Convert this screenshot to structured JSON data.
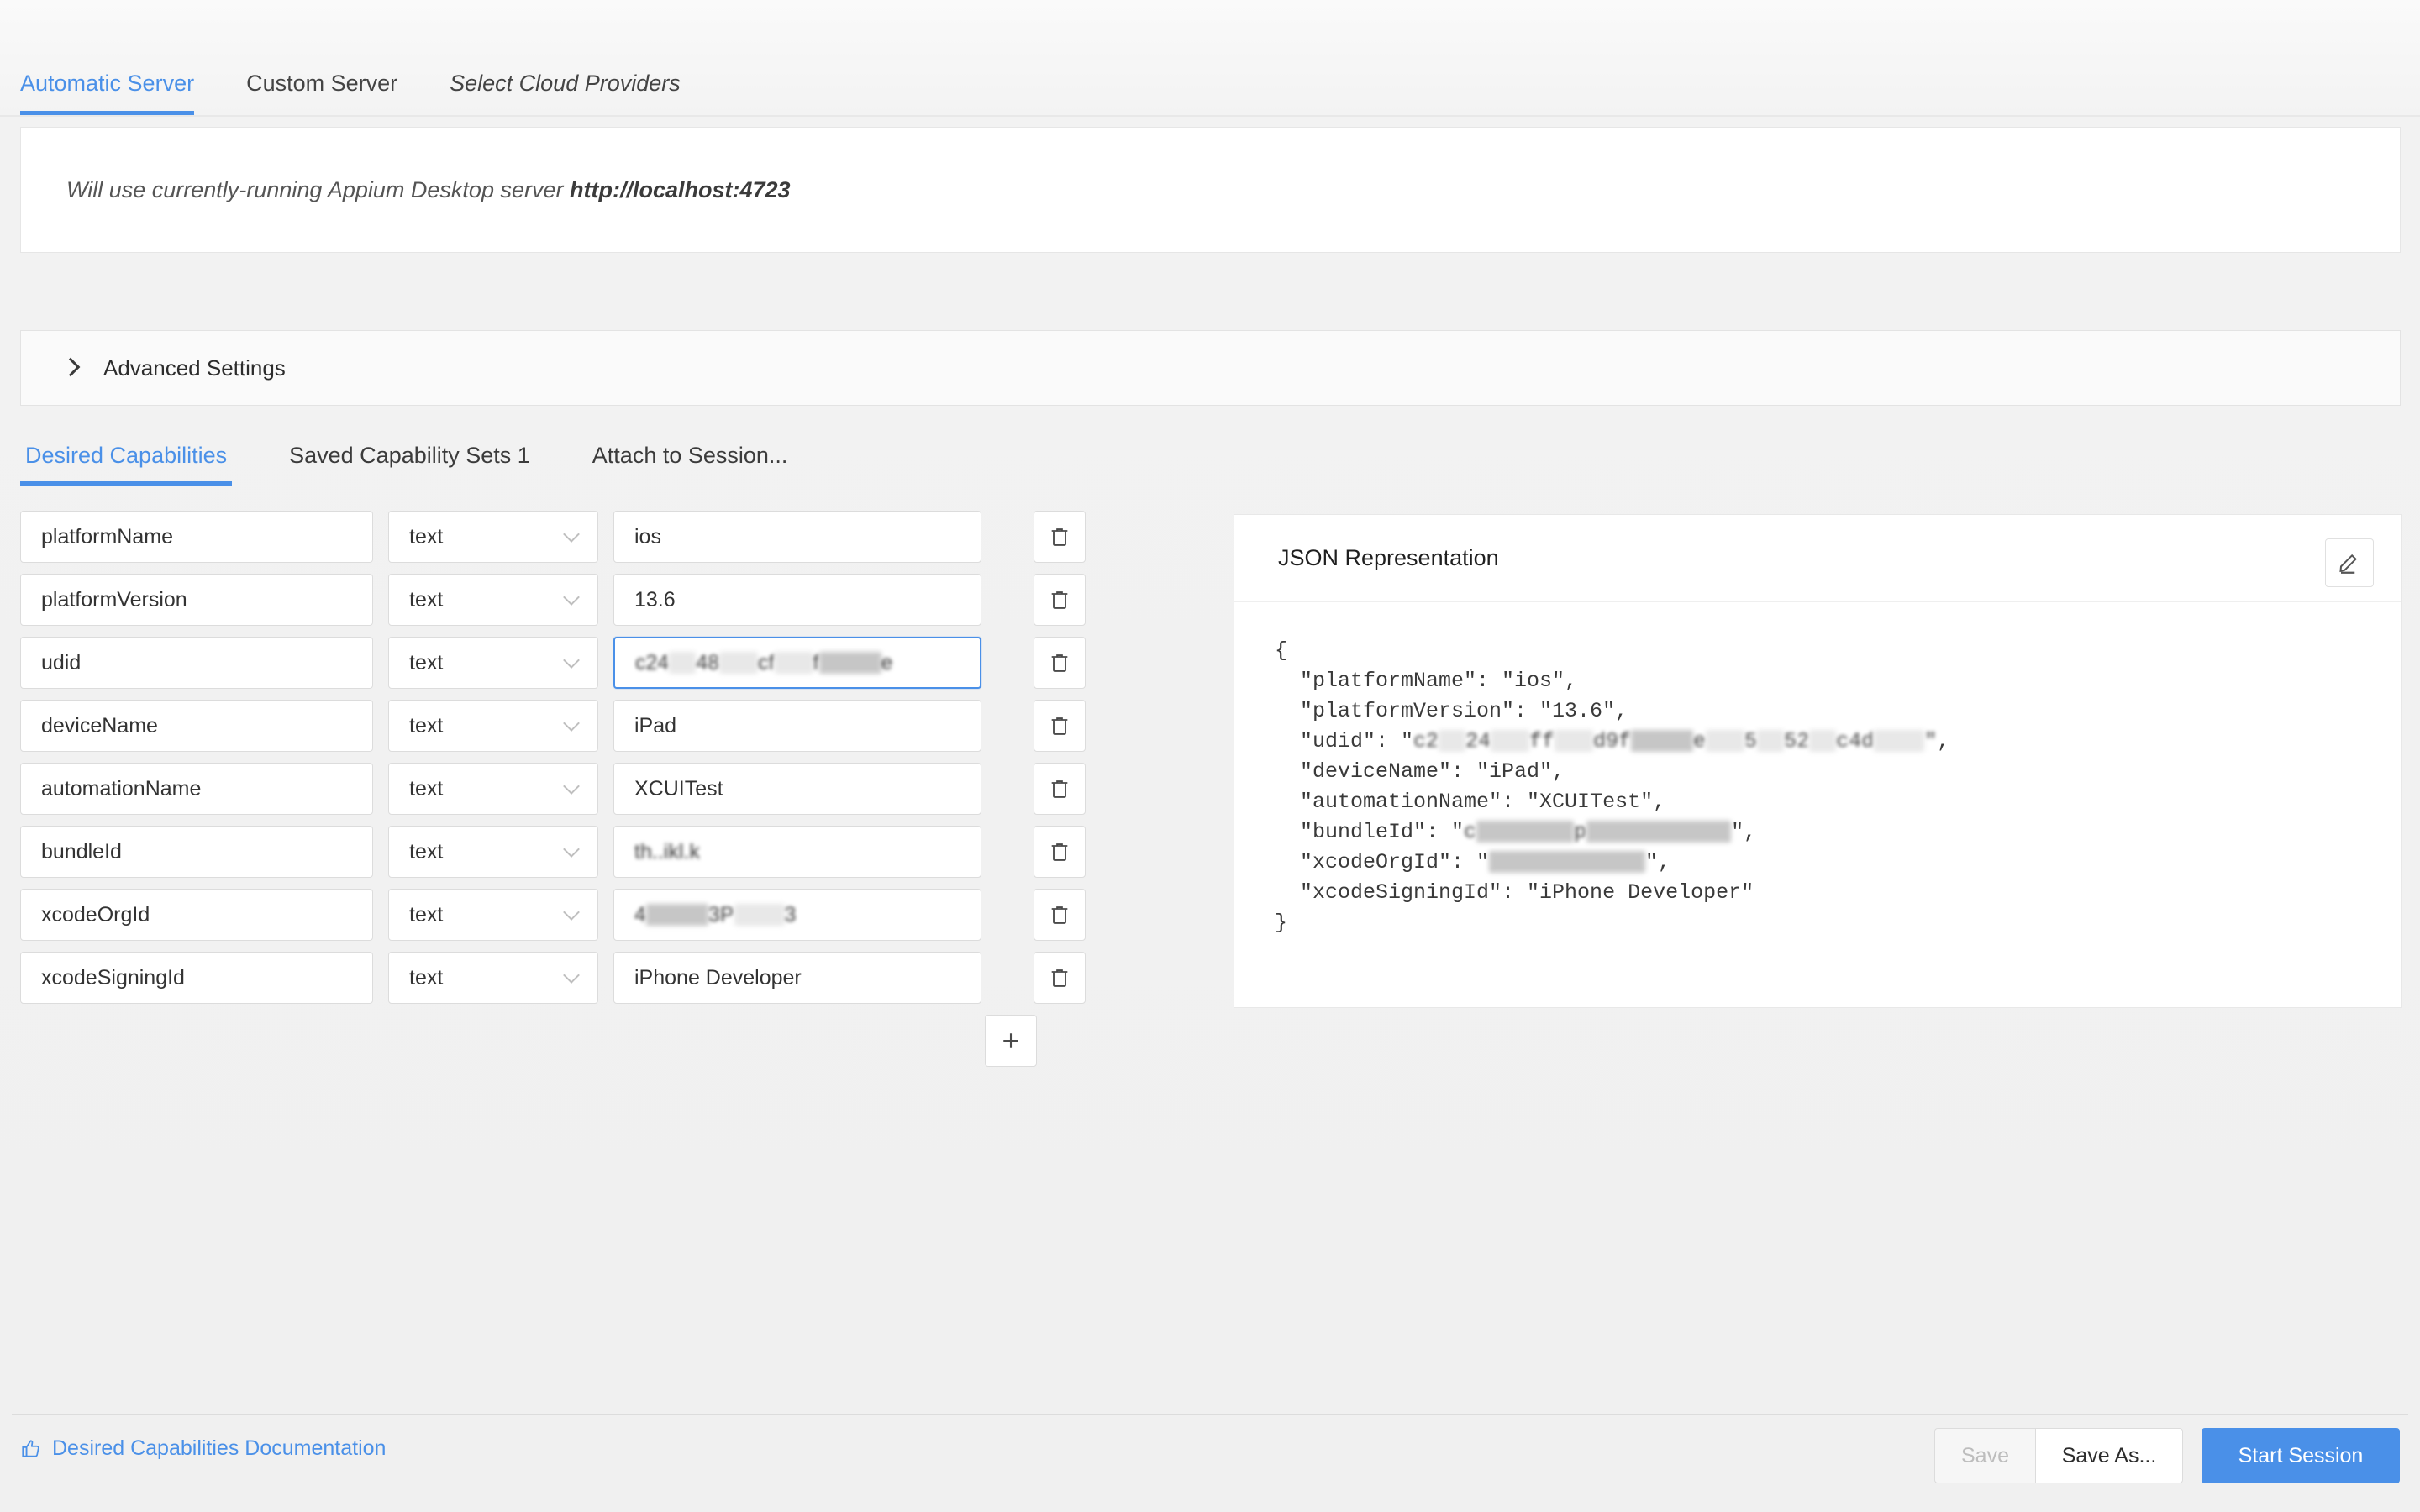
{
  "server_tabs": [
    {
      "label": "Automatic Server",
      "active": true,
      "italic": false
    },
    {
      "label": "Custom Server",
      "active": false,
      "italic": false
    },
    {
      "label": "Select Cloud Providers",
      "active": false,
      "italic": true
    }
  ],
  "server_info": {
    "prefix": "Will use currently-running Appium Desktop server ",
    "url": "http://localhost:4723"
  },
  "advanced": {
    "label": "Advanced Settings",
    "expanded": false
  },
  "caps_tabs": [
    {
      "label": "Desired Capabilities",
      "active": true
    },
    {
      "label": "Saved Capability Sets 1",
      "active": false
    },
    {
      "label": "Attach to Session...",
      "active": false
    }
  ],
  "capabilities": [
    {
      "name": "platformName",
      "type": "text",
      "value": "ios",
      "redacted": false,
      "focused": false
    },
    {
      "name": "platformVersion",
      "type": "text",
      "value": "13.6",
      "redacted": false,
      "focused": false
    },
    {
      "name": "udid",
      "type": "text",
      "value": "c24 48  cf  f    e",
      "redacted": true,
      "focused": true
    },
    {
      "name": "deviceName",
      "type": "text",
      "value": "iPad",
      "redacted": false,
      "focused": false
    },
    {
      "name": "automationName",
      "type": "text",
      "value": "XCUITest",
      "redacted": false,
      "focused": false
    },
    {
      "name": "bundleId",
      "type": "text",
      "value": "th..ikl.k",
      "redacted": true,
      "focused": false
    },
    {
      "name": "xcodeOrgId",
      "type": "text",
      "value": "4    3P   3",
      "redacted": true,
      "focused": false
    },
    {
      "name": "xcodeSigningId",
      "type": "text",
      "value": "iPhone Developer",
      "redacted": false,
      "focused": false
    }
  ],
  "row_actions": {
    "delete_icon": "trash-icon",
    "add_icon": "plus-icon"
  },
  "json_panel": {
    "title": "JSON Representation",
    "edit_icon": "pencil-icon",
    "lines": [
      {
        "text": "{"
      },
      {
        "text": "  \"platformName\": \"ios\","
      },
      {
        "text": "  \"platformVersion\": \"13.6\","
      },
      {
        "text": "  \"udid\": \"",
        "redacted": "c2 24  ff  d9f    e  5 52 c4d   \"",
        "suffix": ","
      },
      {
        "text": "  \"deviceName\": \"iPad\","
      },
      {
        "text": "  \"automationName\": \"XCUITest\","
      },
      {
        "text": "  \"bundleId\": \"",
        "redacted": "c       p           ",
        "suffix": "\","
      },
      {
        "text": "  \"xcodeOrgId\": \"",
        "redacted": "            ",
        "suffix": "\","
      },
      {
        "text": "  \"xcodeSigningId\": \"iPhone Developer\""
      },
      {
        "text": "}"
      }
    ]
  },
  "footer": {
    "doc_link": "Desired Capabilities Documentation",
    "doc_icon": "thumbs-up-icon",
    "save": "Save",
    "save_as": "Save As...",
    "start_session": "Start Session"
  },
  "colors": {
    "accent": "#4a90e8",
    "page_bg": "#f0f0f0",
    "panel_bg": "#ffffff",
    "border": "#dcdcdc",
    "text": "#333333"
  }
}
